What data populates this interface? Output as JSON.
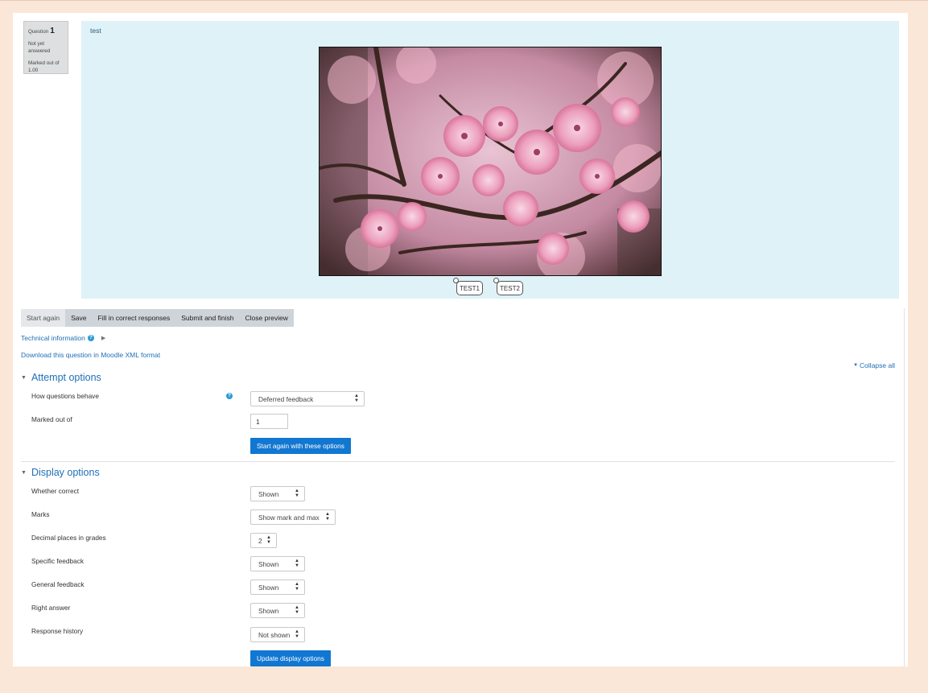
{
  "question_info": {
    "prefix": "Question",
    "number": "1",
    "state": "Not yet answered",
    "marked_out_of": "Marked out of 1.00"
  },
  "question": {
    "text": "test",
    "drag_items": [
      "TEST1",
      "TEST2"
    ]
  },
  "controls": [
    "Start again",
    "Save",
    "Fill in correct responses",
    "Submit and finish",
    "Close preview"
  ],
  "links": {
    "technical_information": "Technical information",
    "download_xml": "Download this question in Moodle XML format",
    "collapse_all": "Collapse all"
  },
  "attempt_options": {
    "title": "Attempt options",
    "behaviour_label": "How questions behave",
    "behaviour_value": "Deferred feedback",
    "marked_out_of_label": "Marked out of",
    "marked_out_of_value": "1",
    "submit_label": "Start again with these options"
  },
  "display_options": {
    "title": "Display options",
    "whether_correct_label": "Whether correct",
    "whether_correct_value": "Shown",
    "marks_label": "Marks",
    "marks_value": "Show mark and max",
    "decimal_label": "Decimal places in grades",
    "decimal_value": "2",
    "specific_feedback_label": "Specific feedback",
    "specific_feedback_value": "Shown",
    "general_feedback_label": "General feedback",
    "general_feedback_value": "Shown",
    "right_answer_label": "Right answer",
    "right_answer_value": "Shown",
    "response_history_label": "Response history",
    "response_history_value": "Not shown",
    "submit_label": "Update display options"
  },
  "icons": {
    "help": "?",
    "triangle_down": "▼",
    "triangle_right": "▶",
    "select_arrows": "▲▼"
  },
  "colors": {
    "link": "#1f6fb6",
    "primary_button": "#1177d1",
    "question_bg": "#def2f8",
    "page_bg": "#fbe7d8"
  }
}
